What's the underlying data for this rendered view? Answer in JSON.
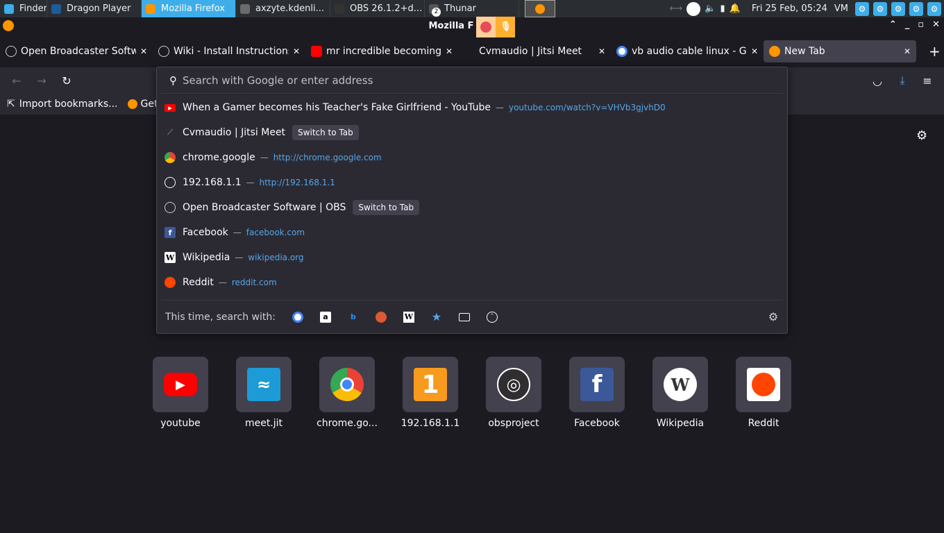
{
  "taskbar": {
    "tasks": [
      {
        "label": "Finder",
        "color": "#3daee9"
      },
      {
        "label": "Dragon Player",
        "color": "#1d5c99"
      },
      {
        "label": "Mozilla Firefox",
        "color": "#ff9500"
      },
      {
        "label": "axzyte.kdenli...",
        "color": "#6b6b6b"
      },
      {
        "label": "OBS 26.1.2+d...",
        "color": "#333333"
      },
      {
        "label": "Thunar",
        "color": "#555555"
      }
    ],
    "thunar_badge": "2",
    "clock": "Fri 25 Feb, 05:24",
    "vm_label": "VM"
  },
  "window": {
    "title": "Mozilla F"
  },
  "tabs": [
    {
      "title": "Open Broadcaster Softw",
      "icon": "obs-icon",
      "color": "#555"
    },
    {
      "title": "Wiki - Install Instructions",
      "icon": "obs-icon",
      "color": "#555"
    },
    {
      "title": "mr incredible becoming",
      "icon": "youtube-icon",
      "color": "#ff0000"
    },
    {
      "title": "Cvmaudio | Jitsi Meet",
      "icon": "jitsi-icon",
      "color": "#1c1b22"
    },
    {
      "title": "vb audio cable linux - Go",
      "icon": "google-icon",
      "color": "#4285f4"
    },
    {
      "title": "New Tab",
      "icon": "firefox-icon",
      "color": "#ff9500"
    }
  ],
  "bookmarks": {
    "import_label": "Import bookmarks...",
    "getting_started": "Get"
  },
  "urlbar": {
    "placeholder": "Search with Google or enter address"
  },
  "results": [
    {
      "title": "When a Gamer becomes his Teacher's Fake Girlfriend - YouTube",
      "url": "youtube.com/watch?v=VHVb3gjvhD0",
      "icon": "youtube-icon",
      "color": "#ff0000"
    },
    {
      "title": "Cvmaudio | Jitsi Meet",
      "switch": "Switch to Tab",
      "icon": "jitsi-icon",
      "color": "#2b2a33"
    },
    {
      "title": "chrome.google",
      "url": "http://chrome.google.com",
      "icon": "chrome-icon",
      "color": "#34a853"
    },
    {
      "title": "192.168.1.1",
      "url": "http://192.168.1.1",
      "icon": "globe-icon",
      "color": "#2b2a33"
    },
    {
      "title": "Open Broadcaster Software | OBS",
      "switch": "Switch to Tab",
      "icon": "obs-icon",
      "color": "#2b2a33"
    },
    {
      "title": "Facebook",
      "url": "facebook.com",
      "icon": "facebook-icon",
      "color": "#3b5998"
    },
    {
      "title": "Wikipedia",
      "url": "wikipedia.org",
      "icon": "wikipedia-icon",
      "color": "#ffffff"
    },
    {
      "title": "Reddit",
      "url": "reddit.com",
      "icon": "reddit-icon",
      "color": "#ff4500"
    }
  ],
  "search_with": {
    "label": "This time, search with:"
  },
  "tiles": [
    {
      "label": "youtube",
      "icon": "youtube-icon",
      "color": "#ff0000",
      "glyph": "▶"
    },
    {
      "label": "meet.jit",
      "icon": "jitsi-icon",
      "color": "#1d9bd7",
      "glyph": "≈"
    },
    {
      "label": "chrome.go...",
      "icon": "chrome-icon",
      "color": "#34a853",
      "glyph": "◉"
    },
    {
      "label": "192.168.1.1",
      "icon": "number-one-icon",
      "color": "#f79a1e",
      "glyph": "1"
    },
    {
      "label": "obsproject",
      "icon": "obs-icon",
      "color": "#302e31",
      "glyph": "◎"
    },
    {
      "label": "Facebook",
      "icon": "facebook-icon",
      "color": "#3b5998",
      "glyph": "f"
    },
    {
      "label": "Wikipedia",
      "icon": "wikipedia-icon",
      "color": "#ffffff",
      "glyph": "W"
    },
    {
      "label": "Reddit",
      "icon": "reddit-icon",
      "color": "#ff4500",
      "glyph": "●"
    }
  ]
}
